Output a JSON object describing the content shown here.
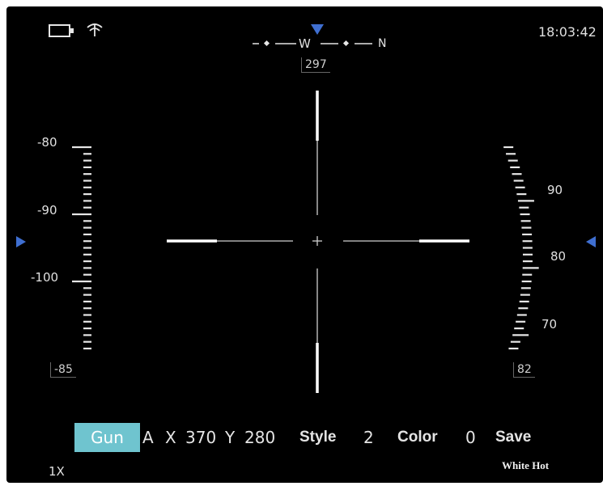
{
  "status": {
    "time": "18:03:42",
    "battery_icon": "battery-icon",
    "wifi_icon": "wifi-icon"
  },
  "compass": {
    "label_w": "W",
    "label_n": "N",
    "heading": "297"
  },
  "left_scale": {
    "labels": [
      "-80",
      "-90",
      "-100"
    ],
    "value": "-85"
  },
  "right_scale": {
    "labels": [
      "90",
      "80",
      "70"
    ],
    "value": "82"
  },
  "menu": {
    "mode": "Gun",
    "profile": "A",
    "x_label": "X",
    "x_value": "370",
    "y_label": "Y",
    "y_value": "280",
    "style_label": "Style",
    "style_value": "2",
    "color_label": "Color",
    "color_value": "0",
    "save_label": "Save"
  },
  "zoom": "1X",
  "palette": "White Hot",
  "colors": {
    "accent": "#6fc4cf",
    "indicator": "#3f6fd1",
    "background": "#000000",
    "foreground": "#e6e6e6"
  }
}
